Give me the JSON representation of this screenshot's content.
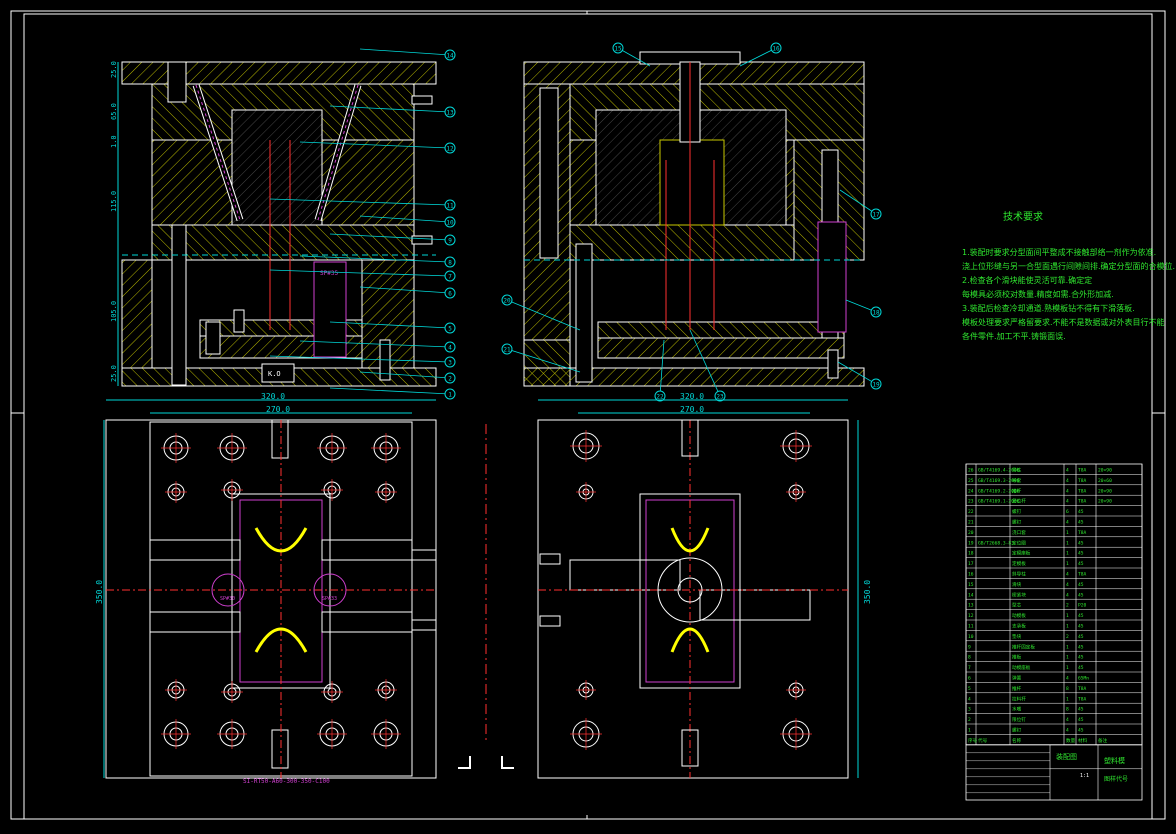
{
  "drawing": {
    "tech_title": "技术要求",
    "tech_lines": [
      "1.装配时要求分型面间平整成不接触部络一剂作为依准.",
      "浇上位形缝与另一合型面遇行间隙间排.确定分型面的合模位.",
      "2.检查各个滑块能使灵活可靠.确定定",
      "每模具必须校对数量.精度如需.合外形加减.",
      "3.装配后检查冷却通道.熟模板钻不得有下滑落板.",
      "模板处理要求严格留要求.不能不是数据或对外表目行不能",
      "各件零件.加工不平.铸锻面误."
    ],
    "dim_width_outer": "320.0",
    "dim_width_inner": "270.0",
    "dim_height": "350.0",
    "dims_left": [
      "25.0",
      "65.0",
      "1.0",
      "115.0",
      "105.0",
      "25.0"
    ],
    "label_spring": "SP#35",
    "label_ko": "K.O",
    "label_spec": "SI-RT50-A60-300-350-C100",
    "label_sp_a": "SP#30",
    "label_sp_b": "SP#33",
    "callouts_left": [
      "14",
      "13",
      "12",
      "11",
      "10",
      "9",
      "8",
      "7",
      "6",
      "5",
      "4",
      "3",
      "2",
      "1"
    ],
    "callouts_top": [
      "15",
      "16",
      "17"
    ],
    "callouts_right": [
      "18",
      "19",
      "20",
      "21",
      "22",
      "23"
    ],
    "callout_right_17": "17",
    "callout_right_18": "18",
    "callout_right_19": "19",
    "bom_rows": [
      {
        "no": "26",
        "code": "GB/T4169.4-2006",
        "name": "导柱",
        "qty": "4",
        "mat": "T8A",
        "note": "20×90"
      },
      {
        "no": "25",
        "code": "GB/T4169.3-2006",
        "name": "导套",
        "qty": "4",
        "mat": "T8A",
        "note": "20×60"
      },
      {
        "no": "24",
        "code": "GB/T4169.2-2006",
        "name": "推杆",
        "qty": "4",
        "mat": "T8A",
        "note": "20×90"
      },
      {
        "no": "23",
        "code": "GB/T4169.1-2006",
        "name": "复位杆",
        "qty": "4",
        "mat": "T8A",
        "note": "20×90"
      },
      {
        "no": "22",
        "code": "",
        "name": "螺钉",
        "qty": "6",
        "mat": "45",
        "note": ""
      },
      {
        "no": "21",
        "code": "",
        "name": "螺钉",
        "qty": "4",
        "mat": "45",
        "note": ""
      },
      {
        "no": "20",
        "code": "",
        "name": "浇口套",
        "qty": "1",
        "mat": "T8A",
        "note": ""
      },
      {
        "no": "19",
        "code": "GB/T2668.3-83",
        "name": "定位圈",
        "qty": "1",
        "mat": "45",
        "note": ""
      },
      {
        "no": "18",
        "code": "",
        "name": "定模座板",
        "qty": "1",
        "mat": "45",
        "note": ""
      },
      {
        "no": "17",
        "code": "",
        "name": "定模板",
        "qty": "1",
        "mat": "45",
        "note": ""
      },
      {
        "no": "16",
        "code": "",
        "name": "斜导柱",
        "qty": "4",
        "mat": "T8A",
        "note": ""
      },
      {
        "no": "15",
        "code": "",
        "name": "滑块",
        "qty": "4",
        "mat": "45",
        "note": ""
      },
      {
        "no": "14",
        "code": "",
        "name": "楔紧块",
        "qty": "4",
        "mat": "45",
        "note": ""
      },
      {
        "no": "13",
        "code": "",
        "name": "型芯",
        "qty": "2",
        "mat": "P20",
        "note": ""
      },
      {
        "no": "12",
        "code": "",
        "name": "动模板",
        "qty": "1",
        "mat": "45",
        "note": ""
      },
      {
        "no": "11",
        "code": "",
        "name": "支承板",
        "qty": "1",
        "mat": "45",
        "note": ""
      },
      {
        "no": "10",
        "code": "",
        "name": "垫块",
        "qty": "2",
        "mat": "45",
        "note": ""
      },
      {
        "no": "9",
        "code": "",
        "name": "推杆固定板",
        "qty": "1",
        "mat": "45",
        "note": ""
      },
      {
        "no": "8",
        "code": "",
        "name": "推板",
        "qty": "1",
        "mat": "45",
        "note": ""
      },
      {
        "no": "7",
        "code": "",
        "name": "动模座板",
        "qty": "1",
        "mat": "45",
        "note": ""
      },
      {
        "no": "6",
        "code": "",
        "name": "弹簧",
        "qty": "4",
        "mat": "65Mn",
        "note": ""
      },
      {
        "no": "5",
        "code": "",
        "name": "推杆",
        "qty": "8",
        "mat": "T8A",
        "note": ""
      },
      {
        "no": "4",
        "code": "",
        "name": "拉料杆",
        "qty": "1",
        "mat": "T8A",
        "note": ""
      },
      {
        "no": "3",
        "code": "",
        "name": "水嘴",
        "qty": "8",
        "mat": "45",
        "note": ""
      },
      {
        "no": "2",
        "code": "",
        "name": "限位钉",
        "qty": "4",
        "mat": "45",
        "note": ""
      },
      {
        "no": "1",
        "code": "",
        "name": "螺钉",
        "qty": "4",
        "mat": "45",
        "note": ""
      }
    ],
    "bom_header": [
      "序号",
      "代号",
      "名称",
      "数量",
      "材料",
      "备注"
    ],
    "title_block": {
      "school": "装配图",
      "title": "塑料模",
      "code": "图样代号",
      "scale": "1:1"
    }
  },
  "colors": {
    "bg": "#000000",
    "line": "#ffffff",
    "hatch": "#c8c800",
    "green": "#2fe62f",
    "cyan": "#00d8d8",
    "red": "#ff3030",
    "magenta": "#d040d0",
    "yellow": "#ffff00"
  }
}
